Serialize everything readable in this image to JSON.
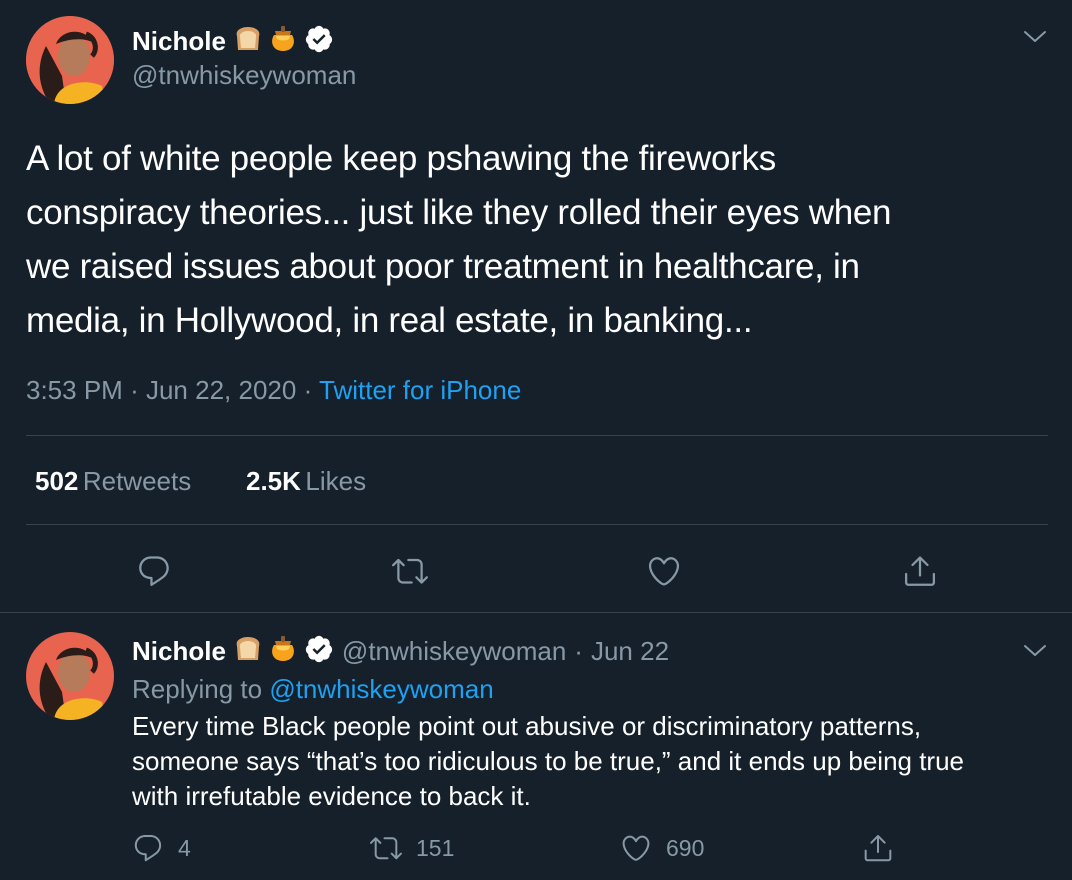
{
  "main_tweet": {
    "display_name": "Nichole",
    "handle": "@tnwhiskeywoman",
    "text_lines": [
      "A lot of white people keep pshawing the fireworks",
      "conspiracy theories... just like they rolled their eyes when",
      "we raised issues about poor treatment in healthcare, in",
      "media, in Hollywood, in real estate, in banking..."
    ],
    "time": "3:53 PM",
    "date": "Jun 22, 2020",
    "source": "Twitter for iPhone",
    "retweets_count": "502",
    "retweets_label": "Retweets",
    "likes_count": "2.5K",
    "likes_label": "Likes"
  },
  "reply_tweet": {
    "display_name": "Nichole",
    "handle": "@tnwhiskeywoman",
    "date": "Jun 22",
    "replying_to_label": "Replying to",
    "replying_to_handle": "@tnwhiskeywoman",
    "text_lines": [
      "Every time Black people point out abusive or discriminatory patterns,",
      "someone says “that’s too ridiculous to be true,” and it ends up being true",
      "with irrefutable evidence to back it."
    ],
    "reply_count": "4",
    "retweet_count": "151",
    "like_count": "690"
  },
  "separator_dot": "·",
  "colors": {
    "background": "#15202b",
    "text": "#ffffff",
    "muted": "#8899a6",
    "link": "#1da1f2",
    "divider": "#38444d"
  },
  "icons": {
    "emoji_1": "bread-emoji",
    "emoji_2": "honey-pot-emoji",
    "badge": "verified-badge-icon",
    "menu": "chevron-down-icon",
    "reply": "reply-icon",
    "retweet": "retweet-icon",
    "like": "heart-icon",
    "share": "share-icon"
  }
}
